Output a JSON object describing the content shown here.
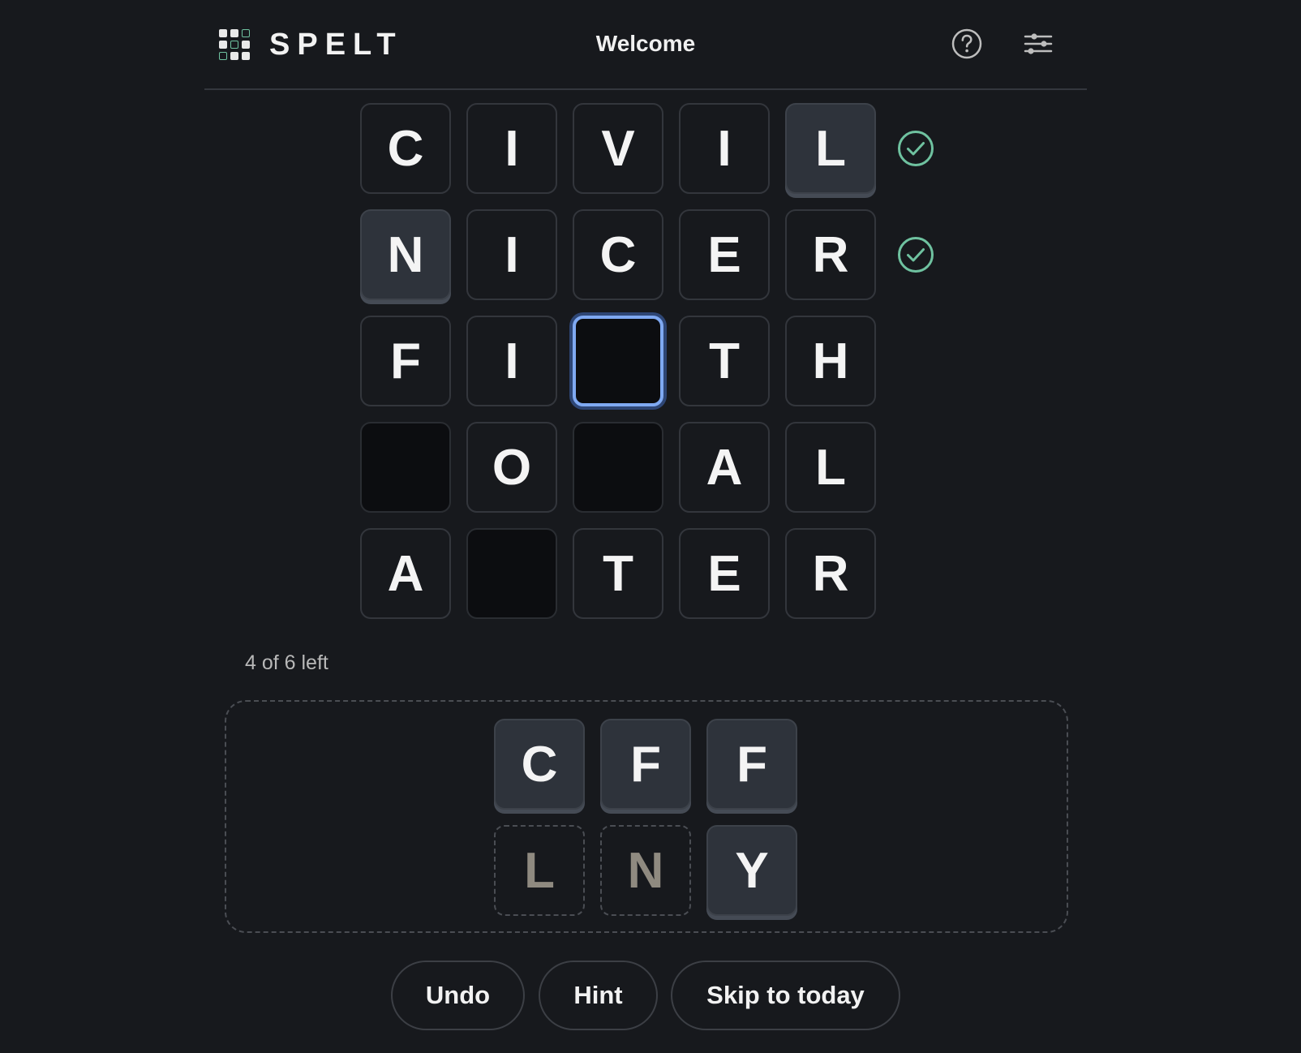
{
  "header": {
    "logo_text": "SPELT",
    "title": "Welcome",
    "help_icon": "question-circle-icon",
    "settings_icon": "sliders-icon"
  },
  "colors": {
    "background": "#17191d",
    "solved_check": "#6fc2a0",
    "selected_outline": "#7fa9f2"
  },
  "grid": {
    "rows": [
      {
        "cells": [
          {
            "letter": "C",
            "state": "fixed"
          },
          {
            "letter": "I",
            "state": "fixed"
          },
          {
            "letter": "V",
            "state": "fixed"
          },
          {
            "letter": "I",
            "state": "fixed"
          },
          {
            "letter": "L",
            "state": "placed"
          }
        ],
        "solved": true
      },
      {
        "cells": [
          {
            "letter": "N",
            "state": "placed"
          },
          {
            "letter": "I",
            "state": "fixed"
          },
          {
            "letter": "C",
            "state": "fixed"
          },
          {
            "letter": "E",
            "state": "fixed"
          },
          {
            "letter": "R",
            "state": "fixed"
          }
        ],
        "solved": true
      },
      {
        "cells": [
          {
            "letter": "F",
            "state": "fixed"
          },
          {
            "letter": "I",
            "state": "fixed"
          },
          {
            "letter": "",
            "state": "selected"
          },
          {
            "letter": "T",
            "state": "fixed"
          },
          {
            "letter": "H",
            "state": "fixed"
          }
        ],
        "solved": false
      },
      {
        "cells": [
          {
            "letter": "",
            "state": "empty"
          },
          {
            "letter": "O",
            "state": "fixed"
          },
          {
            "letter": "",
            "state": "empty"
          },
          {
            "letter": "A",
            "state": "fixed"
          },
          {
            "letter": "L",
            "state": "fixed"
          }
        ],
        "solved": false
      },
      {
        "cells": [
          {
            "letter": "A",
            "state": "fixed"
          },
          {
            "letter": "",
            "state": "empty"
          },
          {
            "letter": "T",
            "state": "fixed"
          },
          {
            "letter": "E",
            "state": "fixed"
          },
          {
            "letter": "R",
            "state": "fixed"
          }
        ],
        "solved": false
      }
    ]
  },
  "status": {
    "remaining": "4 of 6 left"
  },
  "tray": {
    "rows": [
      [
        {
          "letter": "C",
          "used": false
        },
        {
          "letter": "F",
          "used": false
        },
        {
          "letter": "F",
          "used": false
        }
      ],
      [
        {
          "letter": "L",
          "used": true
        },
        {
          "letter": "N",
          "used": true
        },
        {
          "letter": "Y",
          "used": false
        }
      ]
    ]
  },
  "actions": {
    "undo": "Undo",
    "hint": "Hint",
    "skip": "Skip to today"
  }
}
